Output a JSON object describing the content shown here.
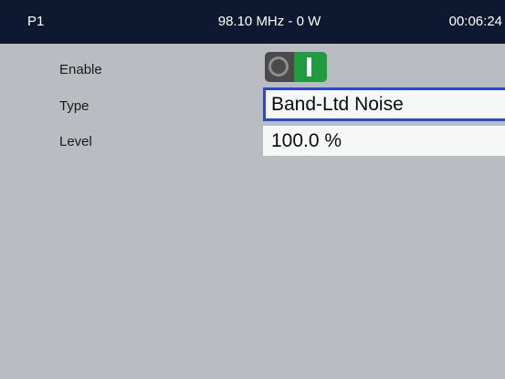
{
  "header": {
    "preset": "P1",
    "frequency_power": "98.10 MHz - 0 W",
    "clock": "00:06:24"
  },
  "settings": {
    "enable": {
      "label": "Enable",
      "value": true
    },
    "type": {
      "label": "Type",
      "value": "Band-Ltd Noise"
    },
    "level": {
      "label": "Level",
      "value": "100.0 %"
    }
  },
  "colors": {
    "header_bg": "#0e1831",
    "body_bg": "#b9bcc1",
    "toggle_on": "#1f9d3e",
    "focus_border": "#2a46d6"
  },
  "icons": {
    "toggle_off": "circle-off-icon",
    "toggle_on": "bar-on-icon"
  }
}
